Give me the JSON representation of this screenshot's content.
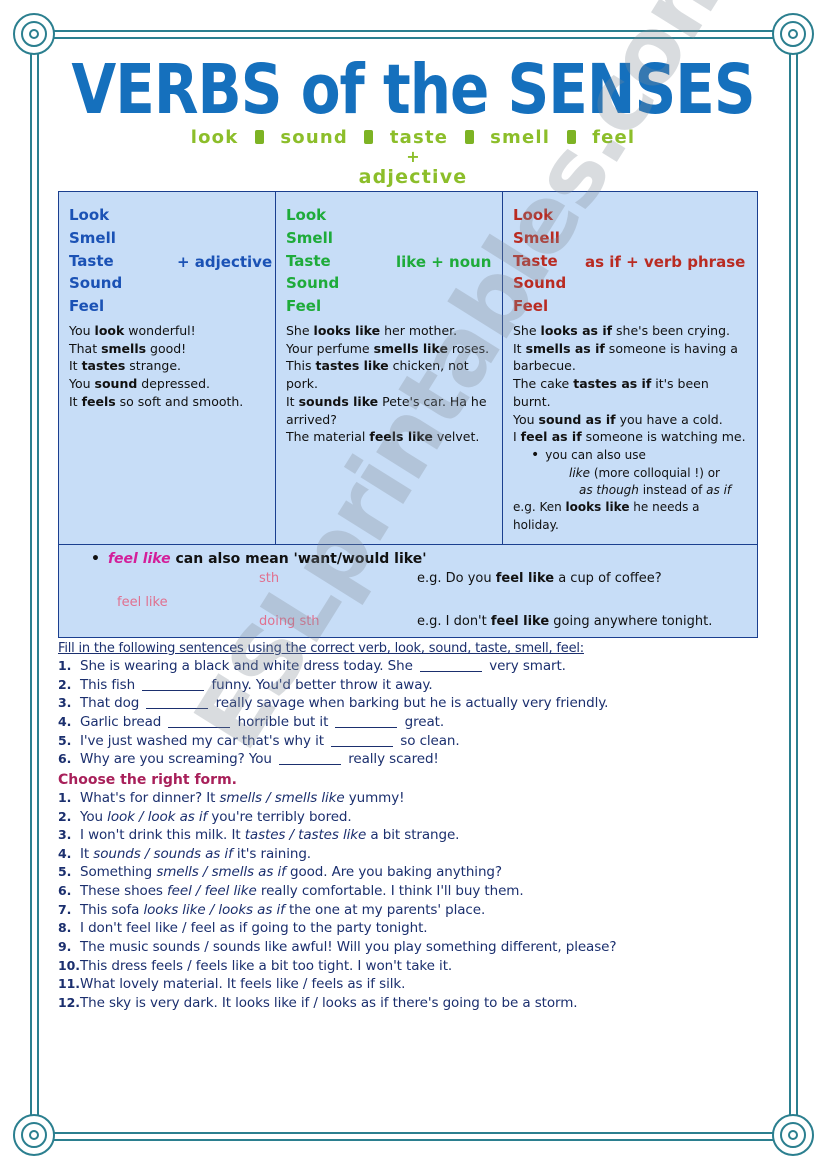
{
  "header": {
    "title": "VERBS of the SENSES",
    "subtitle_words": [
      "look",
      "sound",
      "taste",
      "smell",
      "feel"
    ],
    "subtitle_plus": "+",
    "subtitle_adjective": "adjective",
    "title_color": "#1570bd",
    "subtitle_color": "#8cbe2a"
  },
  "watermark": {
    "text": "ESLprintables.com"
  },
  "grammar_table": {
    "columns": [
      {
        "verbs": [
          "Look",
          "Smell",
          "Taste",
          "Sound",
          "Feel"
        ],
        "pattern": "+ adjective",
        "color": "#1b52b5",
        "examples": [
          {
            "pre": "You ",
            "bold": "look",
            "post": " wonderful!"
          },
          {
            "pre": "That ",
            "bold": "smells",
            "post": " good!"
          },
          {
            "pre": "It ",
            "bold": "tastes",
            "post": " strange."
          },
          {
            "pre": "You ",
            "bold": "sound",
            "post": " depressed."
          },
          {
            "pre": "It ",
            "bold": "feels",
            "post": " so soft and smooth."
          }
        ]
      },
      {
        "verbs": [
          "Look",
          "Smell",
          "Taste",
          "Sound",
          "Feel"
        ],
        "pattern": "like + noun",
        "color": "#1eab3a",
        "examples": [
          {
            "pre": "She ",
            "bold": "looks like",
            "post": " her mother."
          },
          {
            "pre": "Your perfume ",
            "bold": "smells like",
            "post": " roses."
          },
          {
            "pre": "This ",
            "bold": "tastes like",
            "post": " chicken, not pork."
          },
          {
            "pre": "It ",
            "bold": "sounds like",
            "post": " Pete's car. Ha he arrived?"
          },
          {
            "pre": "The material ",
            "bold": "feels like",
            "post": " velvet."
          }
        ]
      },
      {
        "verbs": [
          "Look",
          "Smell",
          "Taste",
          "Sound",
          "Feel"
        ],
        "pattern": "as if + verb phrase",
        "color": "#b92b22",
        "examples": [
          {
            "pre": "She ",
            "bold": "looks as if",
            "post": " she's been crying."
          },
          {
            "pre": "It ",
            "bold": "smells as if",
            "post": " someone is having a barbecue."
          },
          {
            "pre": "The cake ",
            "bold": "tastes as if",
            "post": " it's been burnt."
          },
          {
            "pre": "You ",
            "bold": "sound as if",
            "post": " you have a cold."
          },
          {
            "pre": "I ",
            "bold": "feel as if",
            "post": " someone is watching me."
          }
        ],
        "note": {
          "bullet": "you can also use",
          "line2_italic": "like",
          "line2_rest": " (more colloquial !) or",
          "line3_italic": "as though",
          "line3_rest": " instead of ",
          "line3_italic2": "as if",
          "eg_pre": "e.g. Ken ",
          "eg_bold": "looks like",
          "eg_post": " he needs a holiday."
        }
      }
    ]
  },
  "feel_like_panel": {
    "bullet_em": "feel like",
    "bullet_text": "can also mean 'want/would like'",
    "left_label": "feel like",
    "branch_1_label": "sth",
    "branch_2_label": "doing sth",
    "example_1_pre": "e.g. Do you ",
    "example_1_bold": "feel like",
    "example_1_post": " a cup of coffee?",
    "example_2_pre": "e.g. I don't ",
    "example_2_bold": "feel like",
    "example_2_post": " going anywhere tonight.",
    "em_color": "#d31e9a",
    "label_color": "#e0708f"
  },
  "exercise_1": {
    "heading": "Fill in the following sentences using the correct verb, look, sound, taste, smell, feel:",
    "items": [
      {
        "num": "1.",
        "parts": [
          "She is wearing a black and white dress today. She ",
          "BLANK",
          " very smart."
        ]
      },
      {
        "num": "2.",
        "parts": [
          "This fish ",
          "BLANK",
          " funny. You'd better throw it away."
        ]
      },
      {
        "num": "3.",
        "parts": [
          "That dog ",
          "BLANK",
          " really savage when barking but he is actually very friendly."
        ]
      },
      {
        "num": "4.",
        "parts": [
          "Garlic bread ",
          "BLANK",
          " horrible but it ",
          "BLANK",
          " great."
        ]
      },
      {
        "num": "5.",
        "parts": [
          "I've just washed my car that's why it ",
          "BLANK",
          " so clean."
        ]
      },
      {
        "num": "6.",
        "parts": [
          "Why are you screaming? You ",
          "BLANK",
          " really scared!"
        ]
      }
    ]
  },
  "exercise_2": {
    "heading": "Choose the right form.",
    "heading_color": "#a8205a",
    "items": [
      {
        "num": "1.",
        "pre": "What's for dinner? It ",
        "choice": "smells / smells like",
        "post": " yummy!"
      },
      {
        "num": "2.",
        "pre": "You ",
        "choice": "look / look as if",
        "post": " you're terribly bored."
      },
      {
        "num": "3.",
        "pre": "I won't drink this milk. It ",
        "choice": "tastes / tastes like",
        "post": " a bit strange."
      },
      {
        "num": "4.",
        "pre": "It ",
        "choice": "sounds / sounds as if",
        "post": " it's raining."
      },
      {
        "num": "5.",
        "pre": "Something ",
        "choice": "smells / smells as if",
        "post": " good. Are you baking anything?"
      },
      {
        "num": "6.",
        "pre": "These shoes ",
        "choice": "feel / feel like",
        "post": " really comfortable. I think I'll buy them."
      },
      {
        "num": "7.",
        "pre": "This sofa ",
        "choice": "looks like / looks as if",
        "post": " the one at my parents' place."
      },
      {
        "num": "8.",
        "pre": "I don't ",
        "choice": "feel like / feel as if",
        "post": " going to the party tonight."
      },
      {
        "num": "9.",
        "pre": "The music ",
        "choice": "sounds / sounds like",
        "post": " awful! Will you play something different, please?"
      },
      {
        "num": "10.",
        "pre": "This dress ",
        "choice": "feels / feels like",
        "post": " a bit too tight. I won't take it."
      },
      {
        "num": "11.",
        "pre": "What lovely material. It ",
        "choice": "feels like / feels as if",
        "post": " silk."
      },
      {
        "num": "12.",
        "pre": "The sky is very dark. It ",
        "choice": "looks like if / looks as if",
        "post": " there's going to be a storm."
      }
    ]
  }
}
